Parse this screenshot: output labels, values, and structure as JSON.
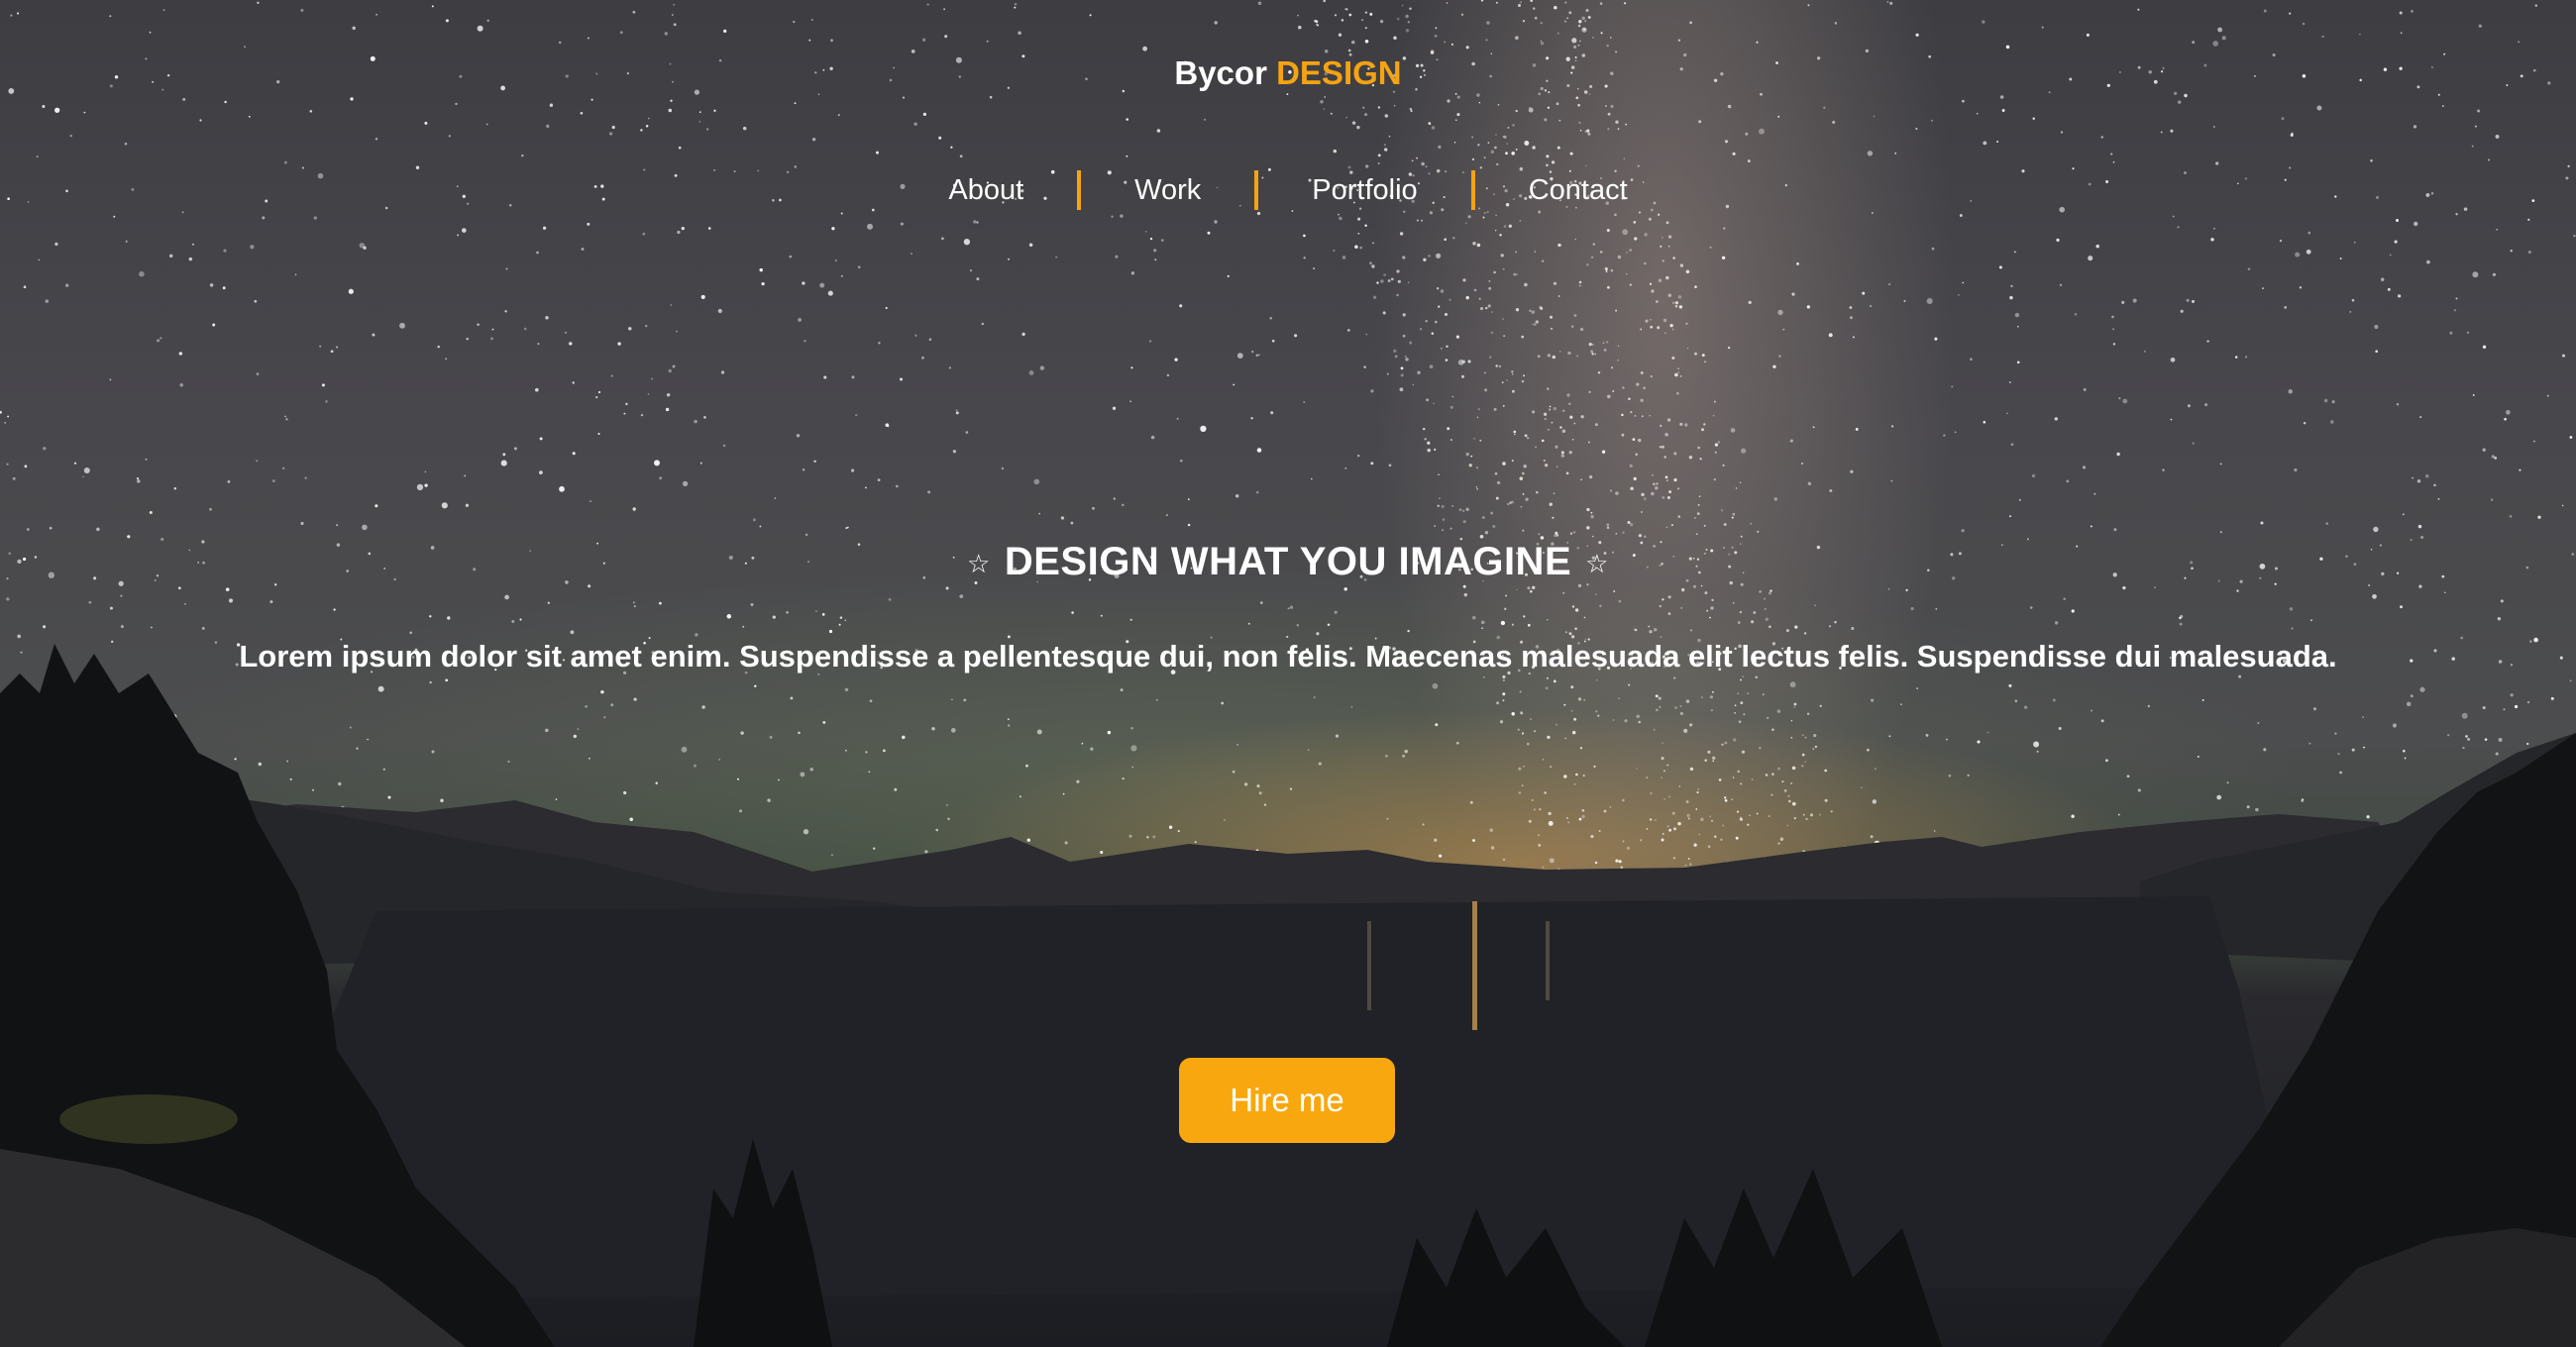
{
  "brand": {
    "name_part1": "Bycor",
    "name_part2": "DESIGN"
  },
  "nav": {
    "items": [
      {
        "label": "About"
      },
      {
        "label": "Work"
      },
      {
        "label": "Portfolio"
      },
      {
        "label": "Contact"
      }
    ]
  },
  "hero": {
    "star_left": "☆",
    "headline": "DESIGN WHAT YOU IMAGINE",
    "star_right": "☆",
    "subline": "Lorem ipsum dolor sit amet enim. Suspendisse a pellentesque dui, non felis. Maecenas malesuada elit lectus felis. Suspendisse dui malesuada.",
    "cta_label": "Hire me"
  },
  "colors": {
    "accent": "#f5a312",
    "button": "#f9a70f",
    "text": "#ffffff"
  }
}
